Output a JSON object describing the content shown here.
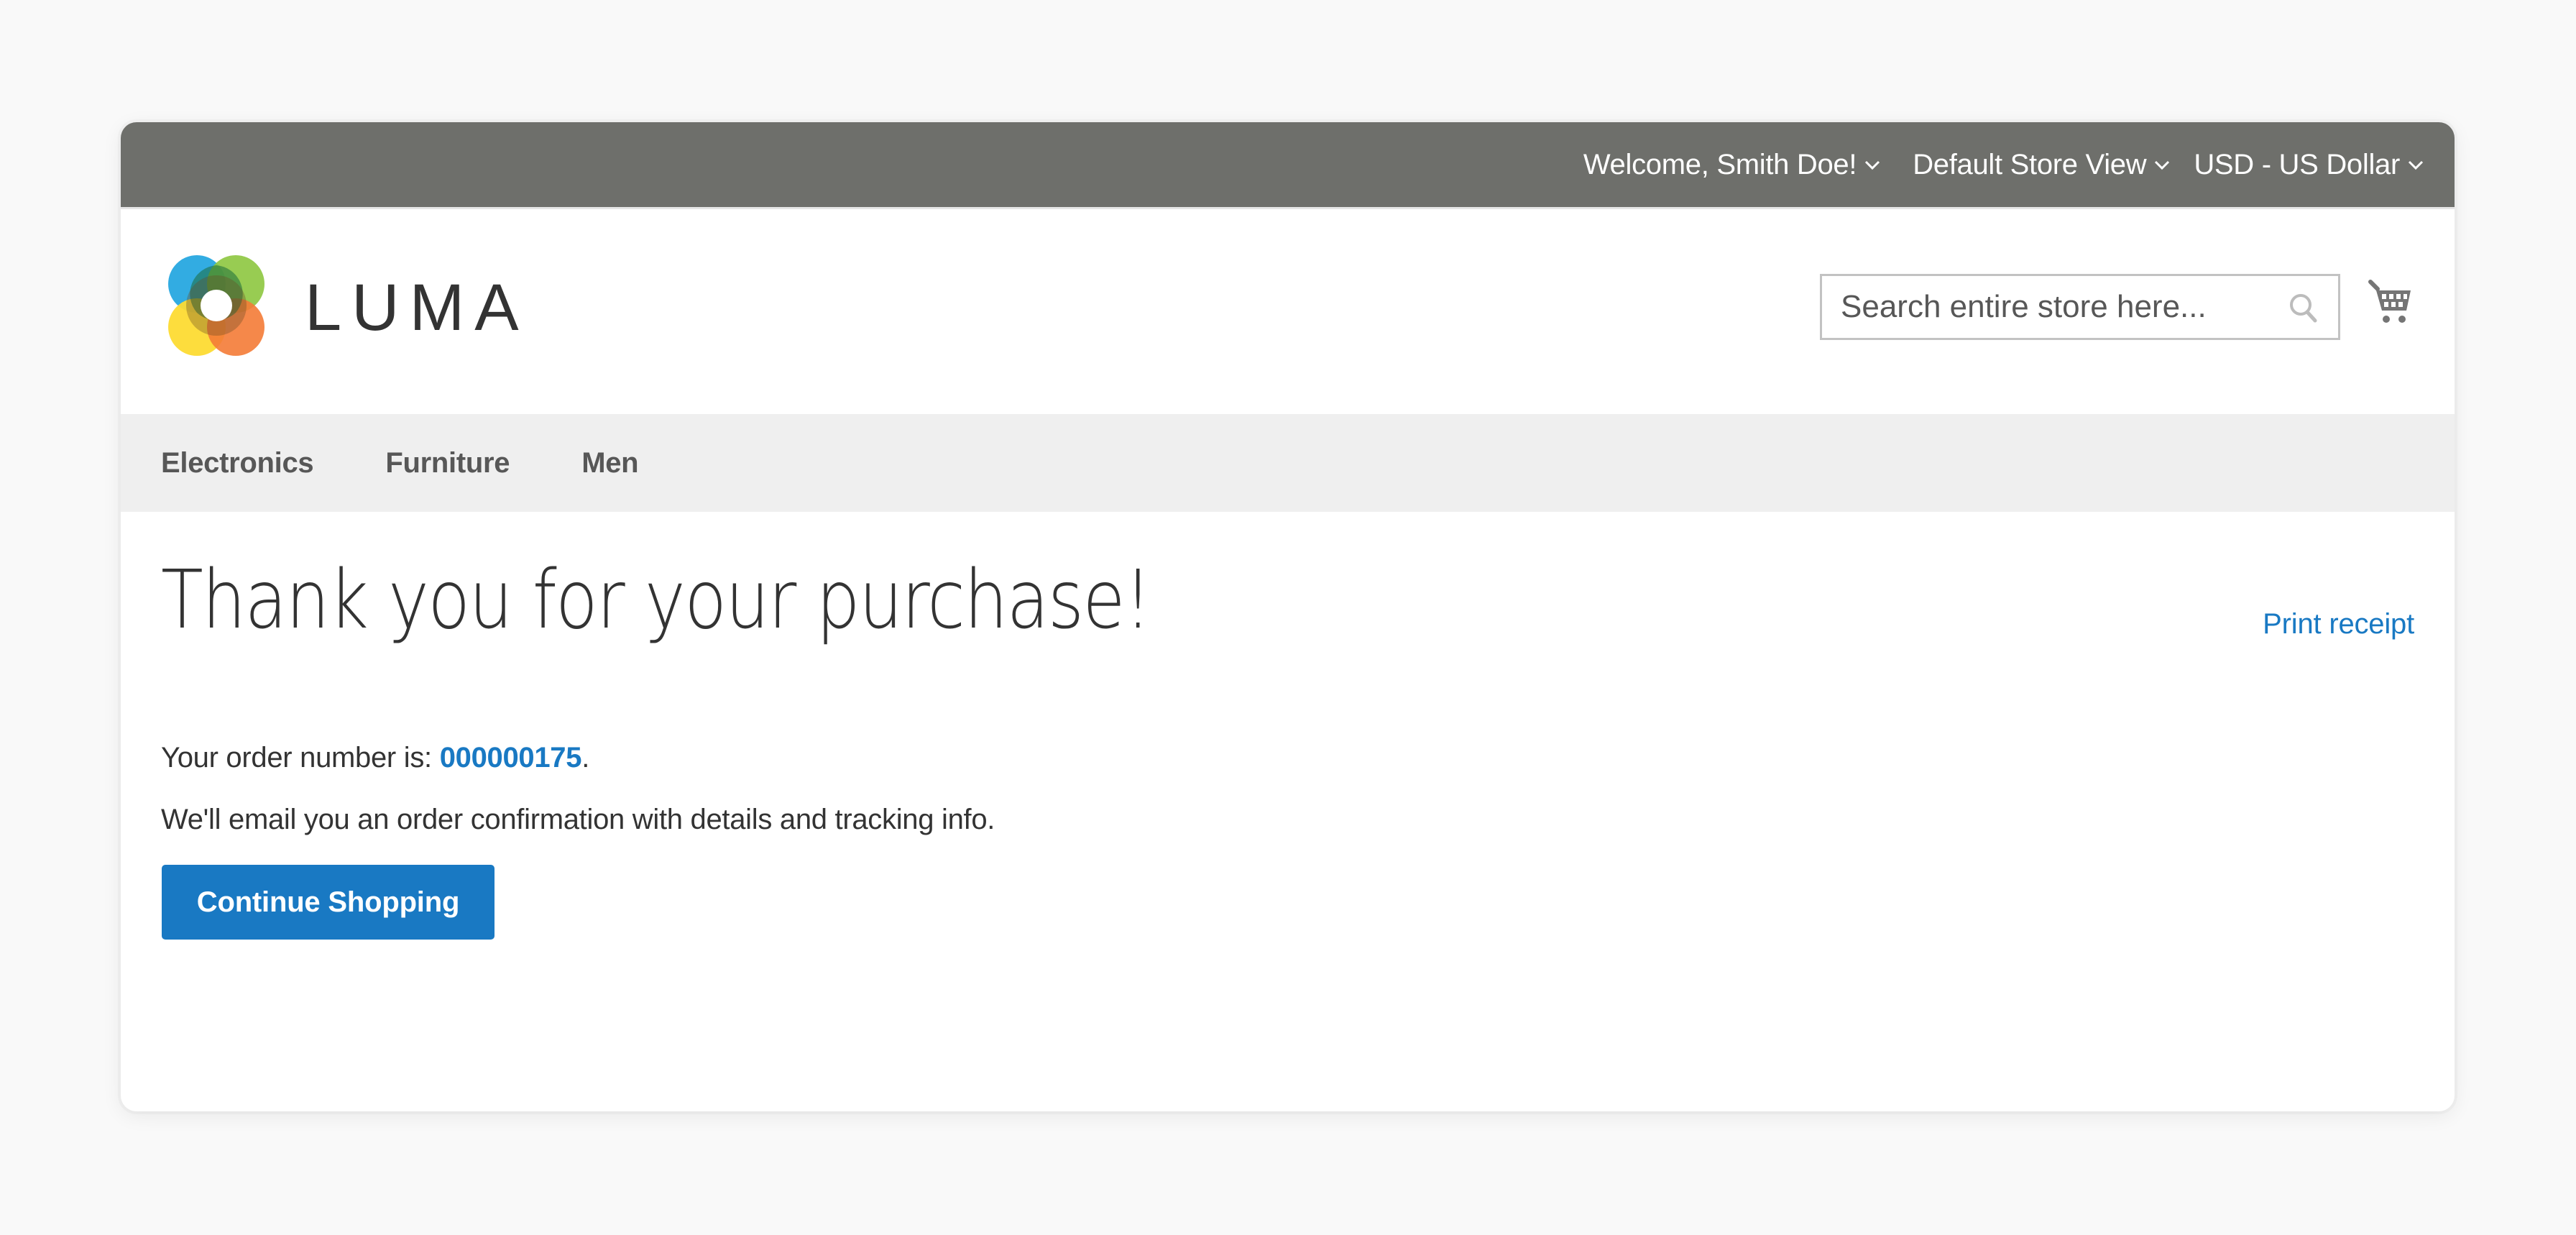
{
  "panel": {
    "welcome": "Welcome, Smith Doe!",
    "store_view": "Default Store View",
    "currency": "USD - US Dollar"
  },
  "header": {
    "logo_text": "LUMA",
    "search_placeholder": "Search entire store here...",
    "search_icon": "search-icon",
    "cart_icon": "cart-icon"
  },
  "nav": {
    "items": [
      {
        "label": "Electronics"
      },
      {
        "label": "Furniture"
      },
      {
        "label": "Men"
      }
    ]
  },
  "main": {
    "title": "Thank you for your purchase!",
    "print_receipt": "Print receipt",
    "order_prefix": "Your order number is: ",
    "order_number": "000000175",
    "order_suffix": ".",
    "email_notice": "We'll email you an order confirmation with details and tracking info.",
    "continue_button": "Continue Shopping"
  },
  "colors": {
    "panel_bg": "#6e6f6b",
    "nav_bg": "#efefef",
    "accent": "#1979c3",
    "text": "#333333"
  }
}
